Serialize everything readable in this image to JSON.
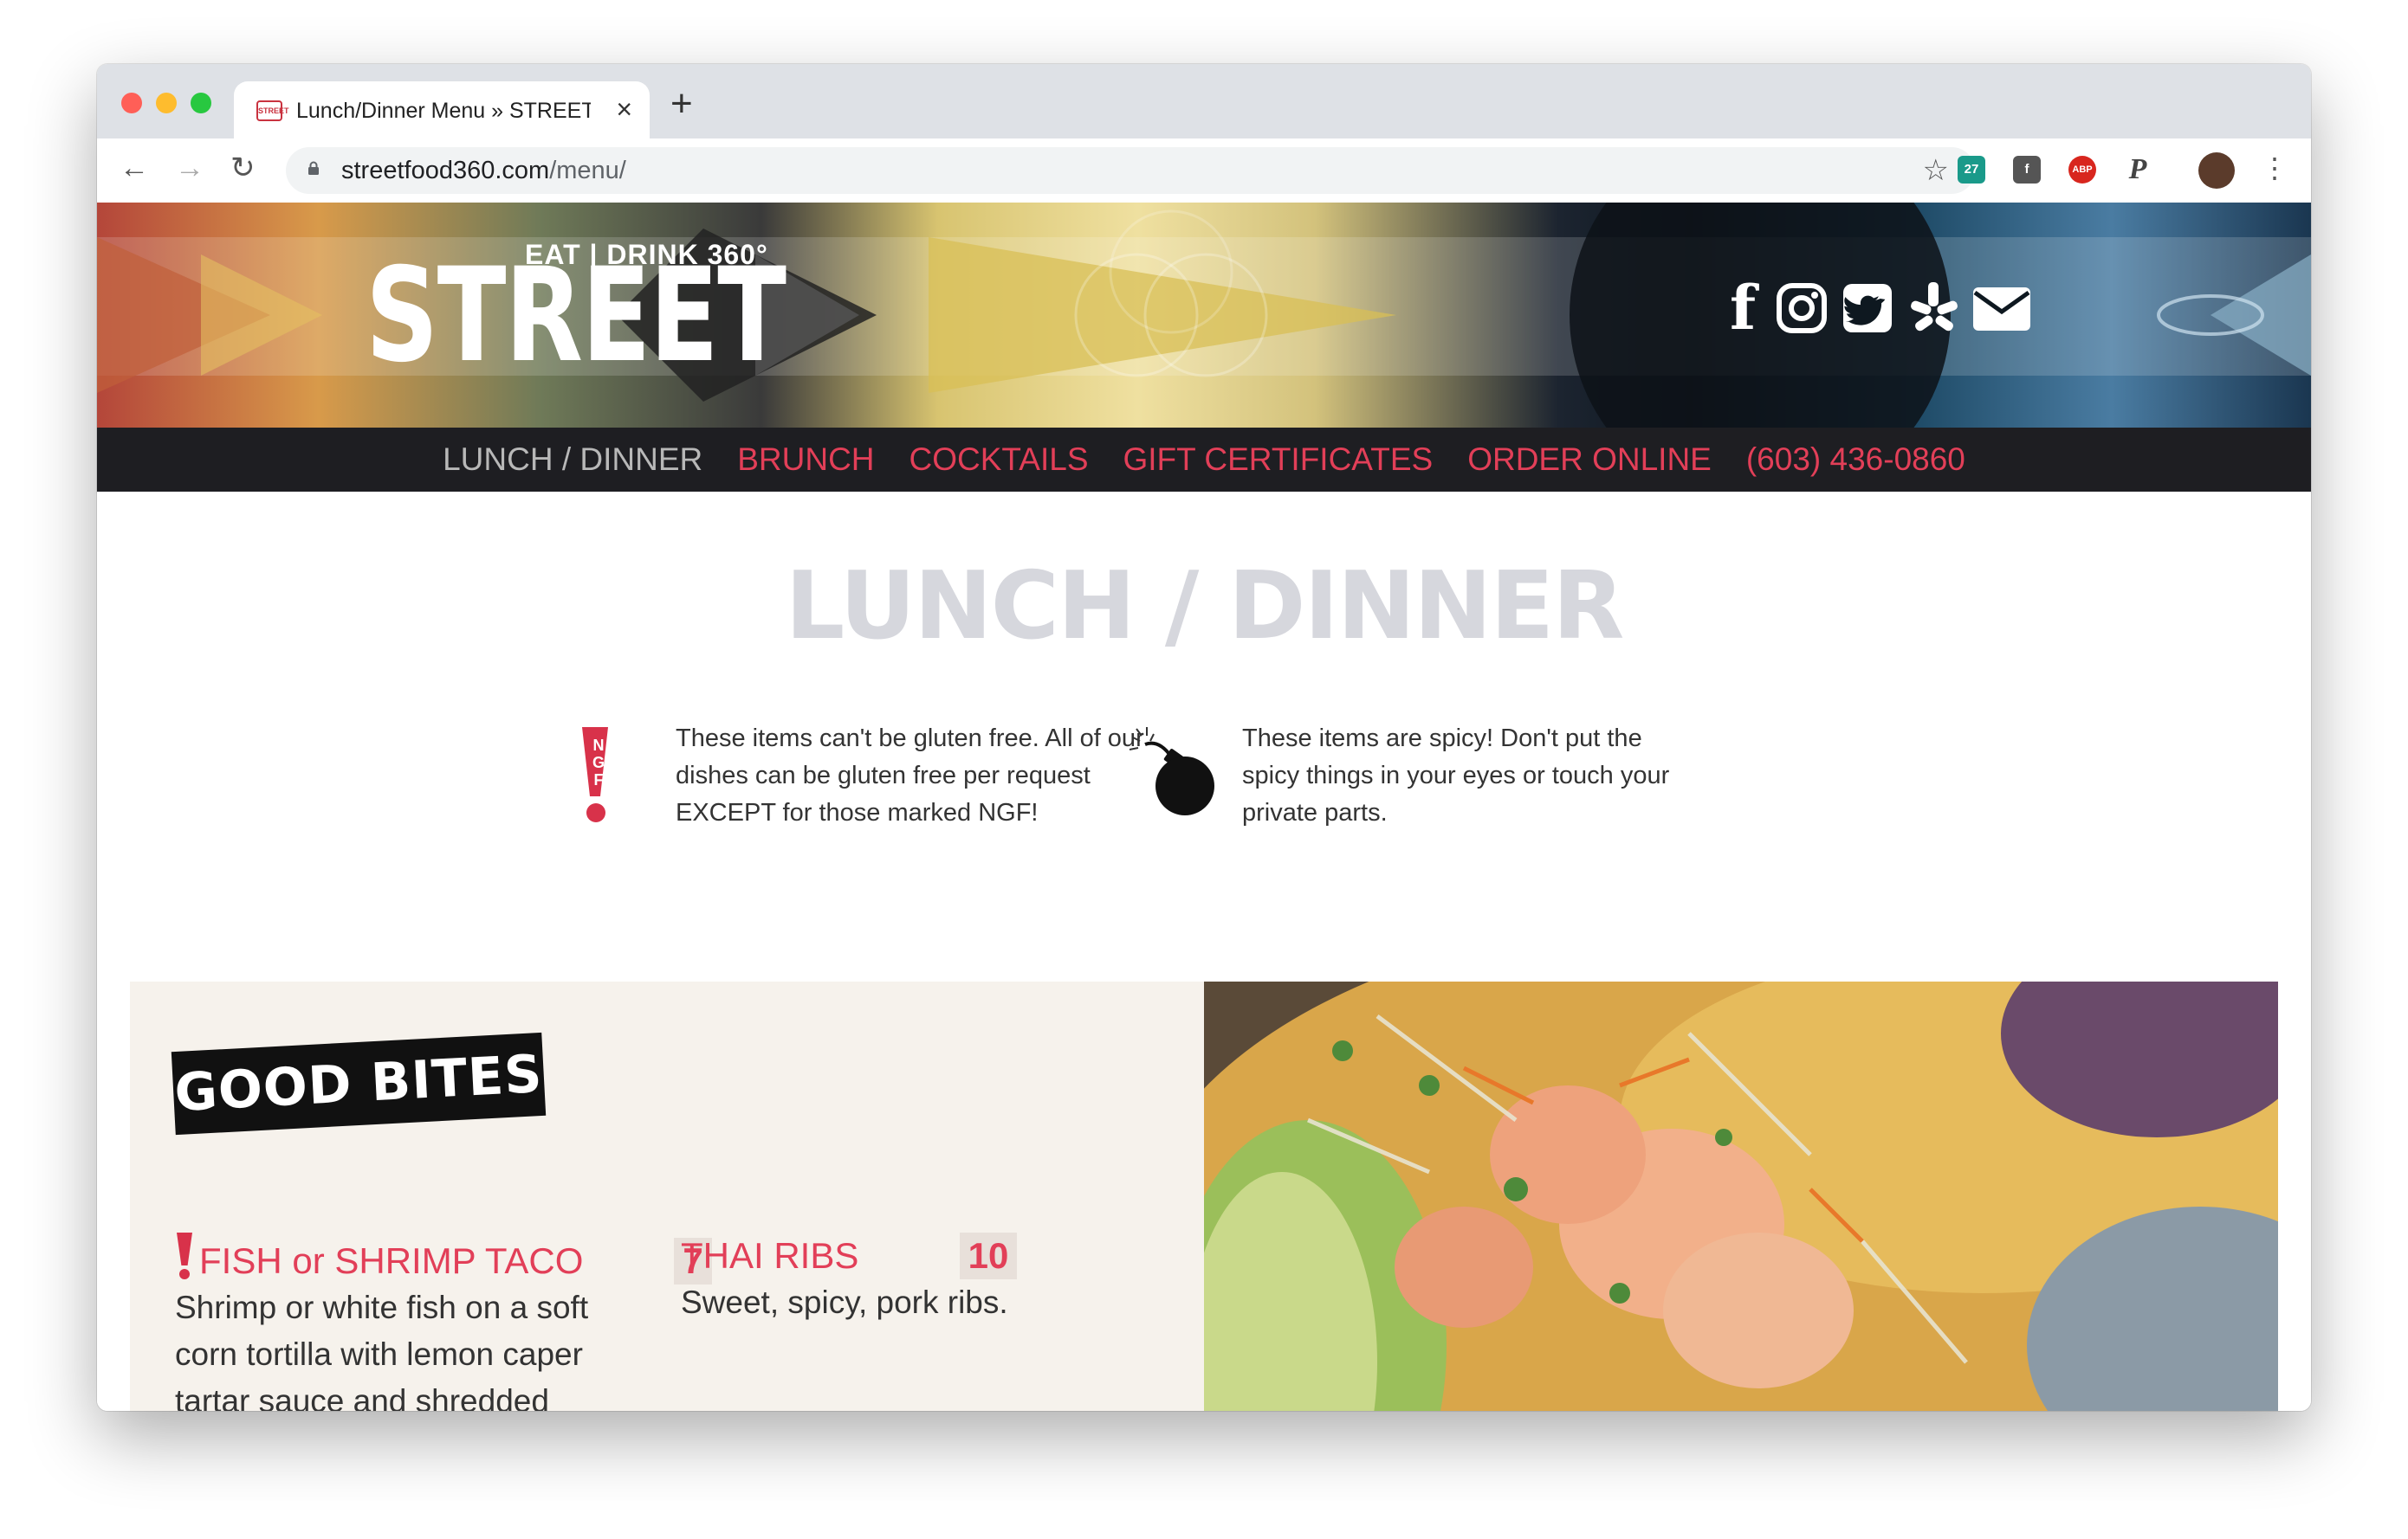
{
  "browser": {
    "tab_title": "Lunch/Dinner Menu » STREET",
    "tab_favicon_text": "STREET",
    "url_domain": "streetfood360.com",
    "url_path": "/menu/",
    "extensions": [
      "27",
      "f",
      "ABP",
      "P"
    ]
  },
  "header": {
    "logo_tagline": "EAT | DRINK 360°",
    "logo_name": "STREET",
    "social": [
      "facebook-icon",
      "instagram-icon",
      "twitter-icon",
      "yelp-icon",
      "email-icon"
    ]
  },
  "nav": {
    "items": [
      "LUNCH / DINNER",
      "BRUNCH",
      "COCKTAILS",
      "GIFT CERTIFICATES",
      "ORDER ONLINE",
      "(603) 436-0860"
    ]
  },
  "page": {
    "title": "LUNCH / DINNER",
    "ngf_label": "NGF",
    "ngf_note": "These items can't be gluten free. All of our dishes can be gluten free per request EXCEPT for those marked NGF!",
    "spicy_note": "These items are spicy! Don't put the spicy things in your eyes or touch your private parts."
  },
  "menu": {
    "section_title": "GOOD BITES",
    "items": [
      {
        "name": "FISH or SHRIMP TACO",
        "price": "7",
        "desc": "Shrimp or white fish on a soft corn tortilla with lemon caper tartar sauce and shredded cabbage."
      },
      {
        "name": "THAI RIBS",
        "price": "10",
        "desc": "Sweet, spicy, pork ribs."
      }
    ]
  },
  "colors": {
    "accent": "#e23f58",
    "nav_bg": "#1e1e22",
    "section_bg": "#f6f2ec",
    "title_gray": "#d6d7dd"
  }
}
